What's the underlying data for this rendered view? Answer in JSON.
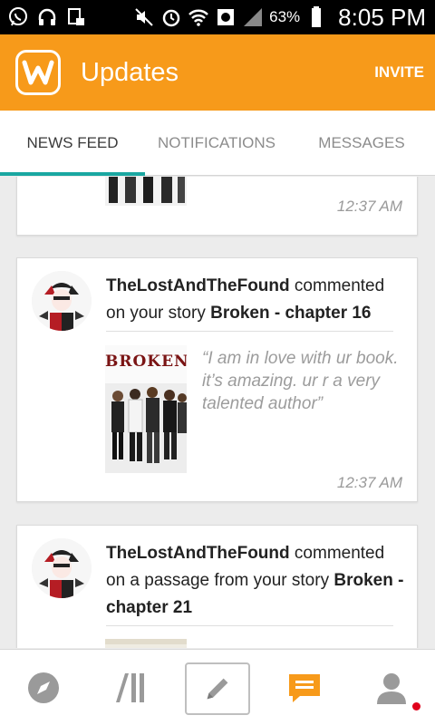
{
  "status_bar": {
    "left_icons": [
      "whatsapp-icon",
      "headphones-icon",
      "screenshot-icon"
    ],
    "right_icons": [
      "mute-icon",
      "alarm-icon",
      "wifi-icon",
      "signal-icon"
    ],
    "battery": "63%",
    "time": "8:05 PM"
  },
  "app_bar": {
    "logo_letter": "w",
    "title": "Updates",
    "invite_label": "INVITE",
    "color": "#f79a1a"
  },
  "tabs": [
    {
      "label": "NEWS FEED",
      "active": true
    },
    {
      "label": "NOTIFICATIONS",
      "active": false
    },
    {
      "label": "MESSAGES",
      "active": false
    }
  ],
  "feed": {
    "card0": {
      "time": "12:37 AM"
    },
    "card1": {
      "user": "TheLostAndTheFound",
      "action": " commented on your story ",
      "story": "Broken - chapter 16",
      "cover_title": "BROKEN",
      "quote": "“I am in love with ur book. it’s amazing. ur r a very talented author”",
      "time": "12:37 AM"
    },
    "card2": {
      "user": "TheLostAndTheFound",
      "action": " commented on a passage from your story ",
      "story": "Broken - chapter 21"
    }
  },
  "bottom_nav": {
    "items": [
      "discover-icon",
      "library-icon",
      "write-icon",
      "updates-icon",
      "profile-icon"
    ],
    "active_color": "#f79a1a",
    "inactive_color": "#9a9a9a"
  }
}
